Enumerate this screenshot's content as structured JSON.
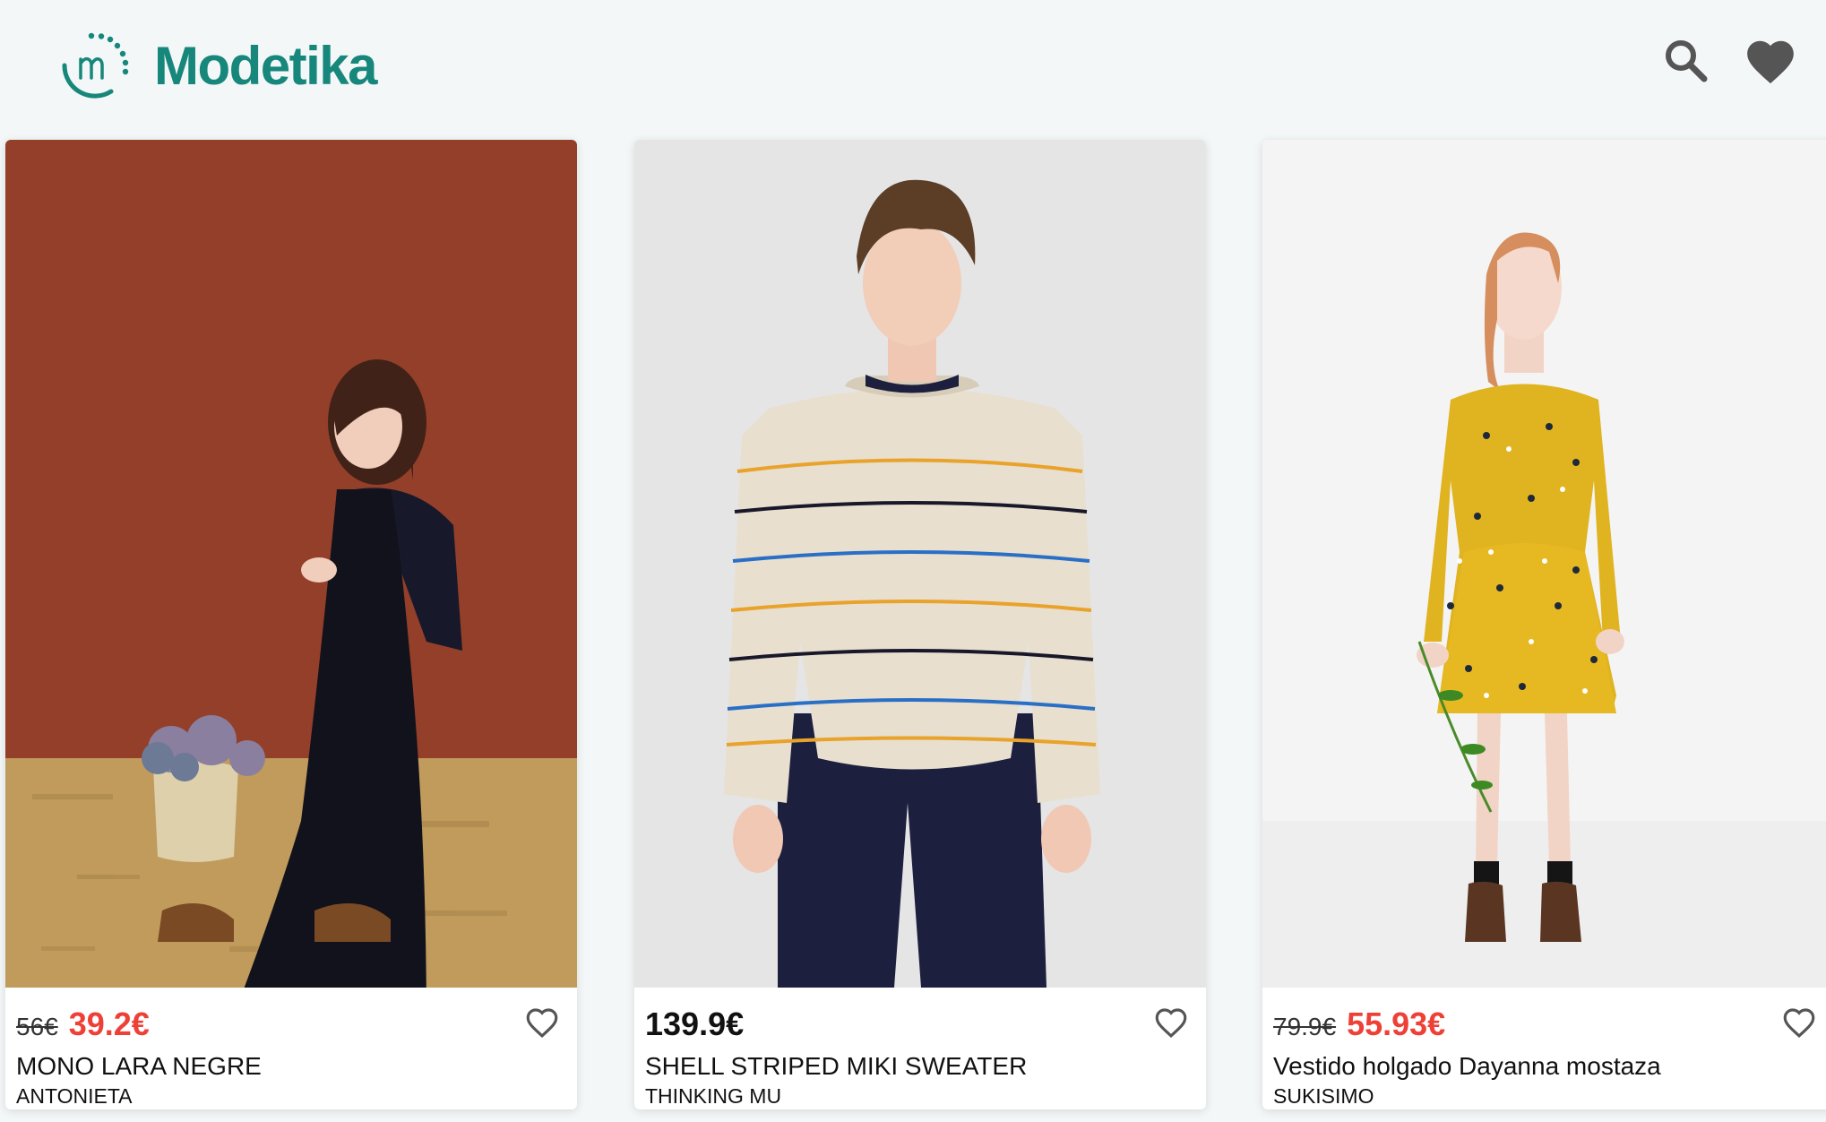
{
  "header": {
    "logo_text": "Modetika",
    "brand_color": "#16877a",
    "icons": [
      "logo-icon",
      "search-icon",
      "heart-icon"
    ]
  },
  "products": [
    {
      "old_price": "56€",
      "price": "39.2€",
      "name": "MONO LARA NEGRE",
      "brand": "ANTONIETA",
      "on_sale": true
    },
    {
      "old_price": "",
      "price": "139.9€",
      "name": "SHELL STRIPED MIKI SWEATER",
      "brand": "THINKING MU",
      "on_sale": false
    },
    {
      "old_price": "79.9€",
      "price": "55.93€",
      "name": "Vestido holgado Dayanna mostaza",
      "brand": "SUKISIMO",
      "on_sale": true
    }
  ],
  "colors": {
    "sale_price": "#ee4036",
    "page_background": "#f3f7f8"
  }
}
